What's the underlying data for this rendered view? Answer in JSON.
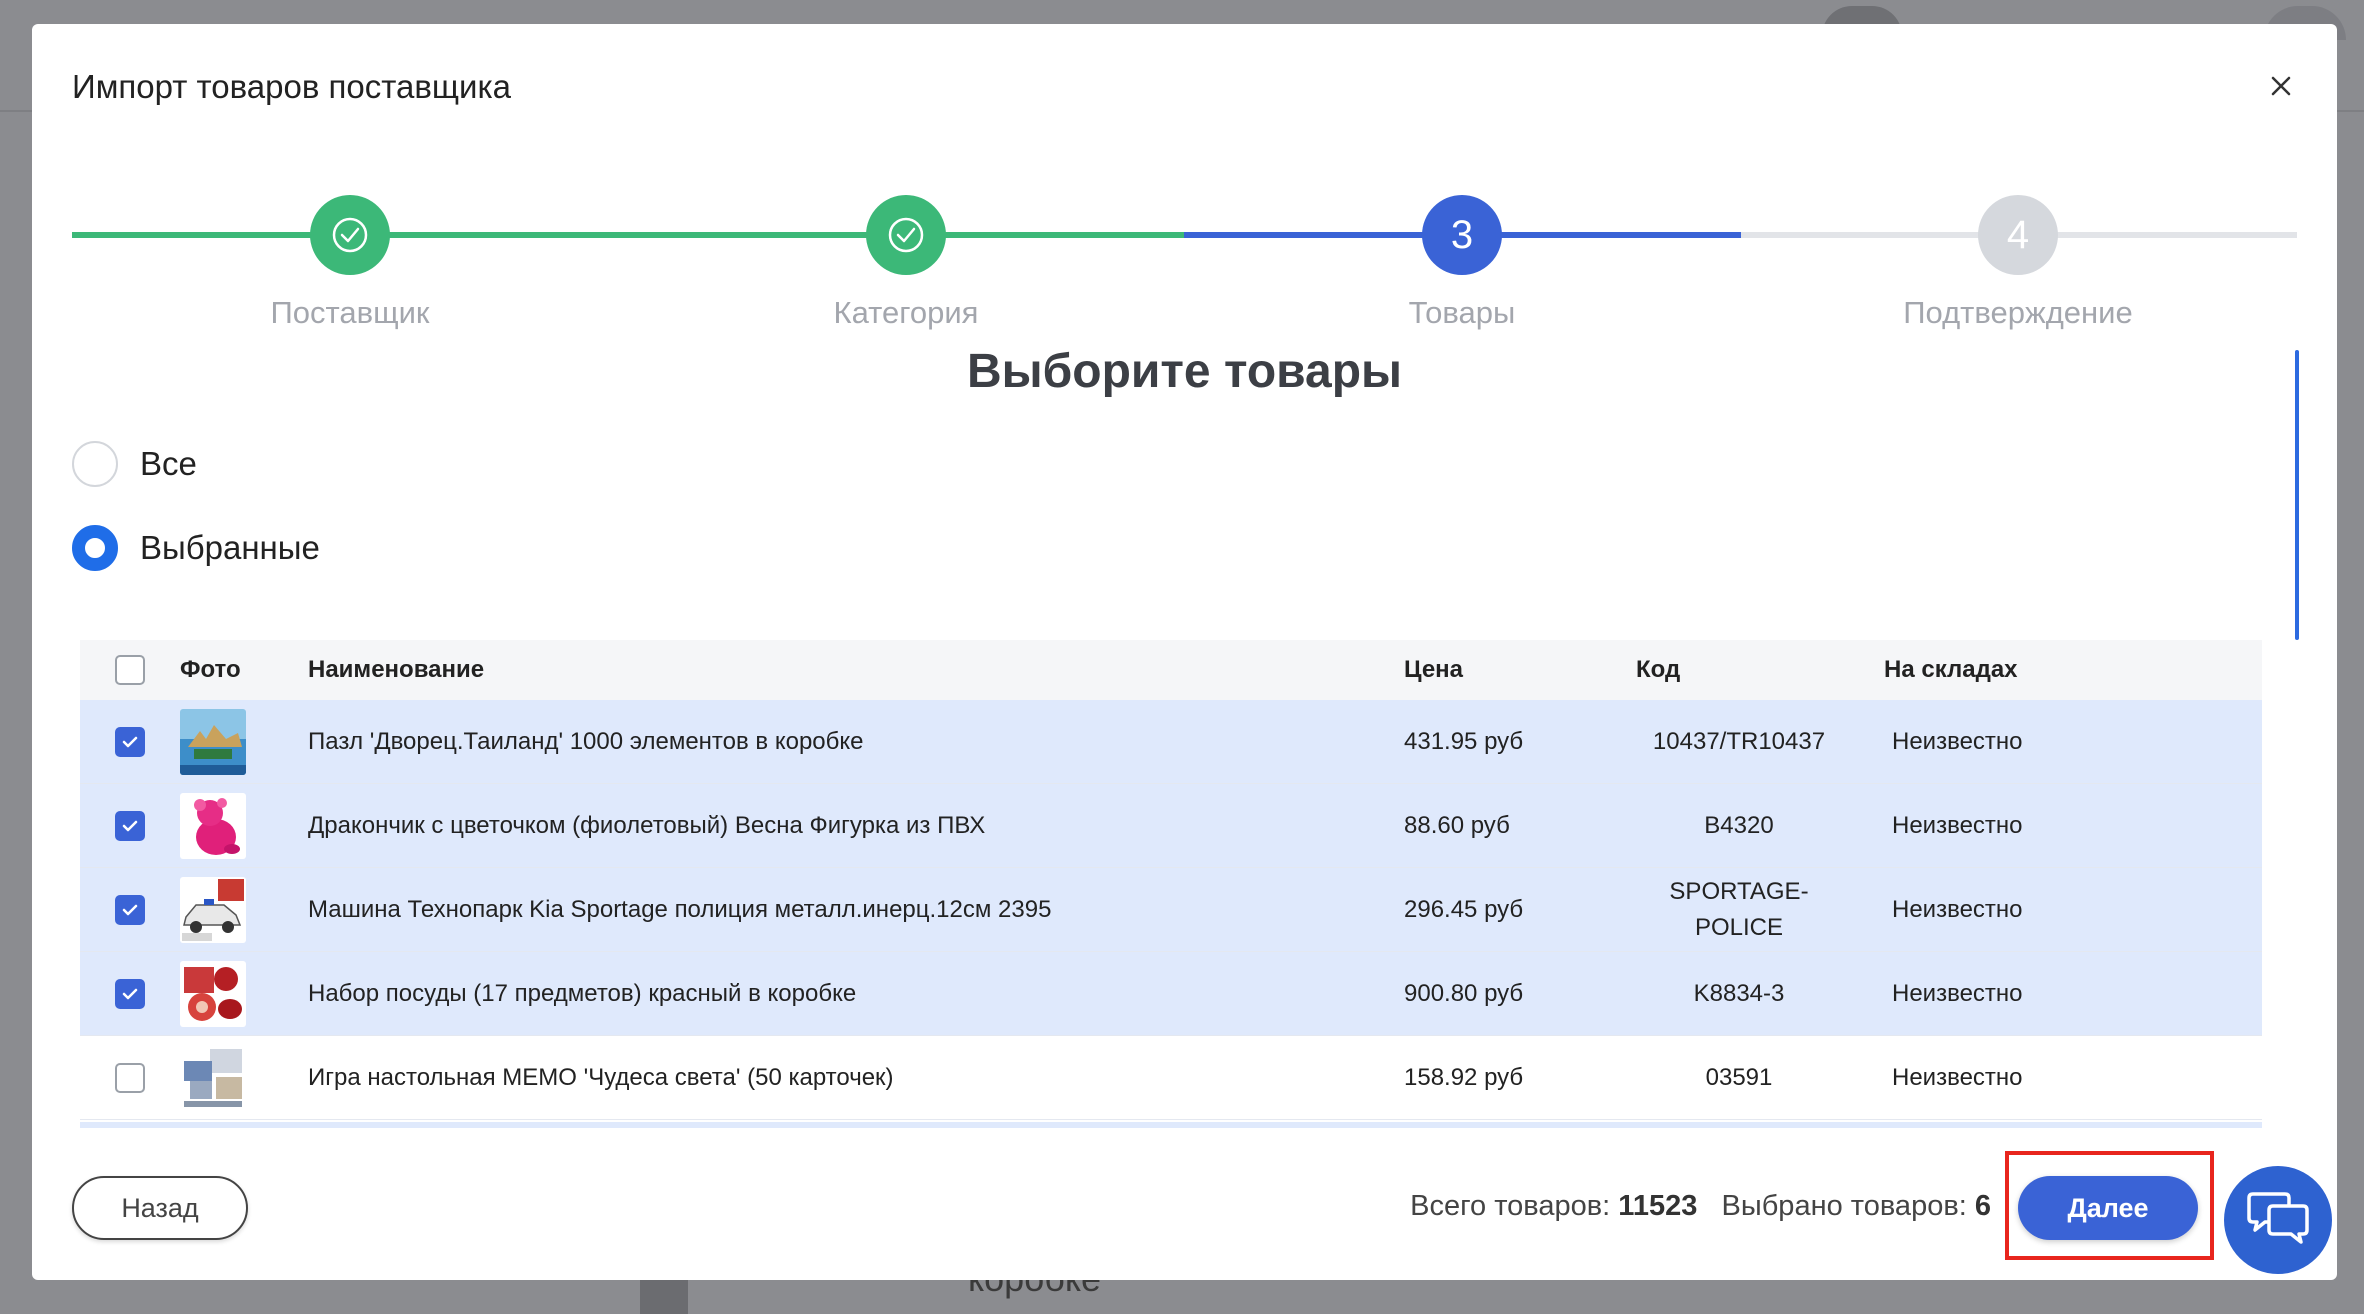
{
  "modal": {
    "title": "Импорт товаров поставщика",
    "heading": "Выборите товары"
  },
  "steps": [
    {
      "label": "Поставщик",
      "number": "1",
      "state": "done"
    },
    {
      "label": "Категория",
      "number": "2",
      "state": "done"
    },
    {
      "label": "Товары",
      "number": "3",
      "state": "active"
    },
    {
      "label": "Подтверждение",
      "number": "4",
      "state": "todo"
    }
  ],
  "filter": {
    "all_label": "Все",
    "selected_label": "Выбранные",
    "selected_value": "Выбранные"
  },
  "table": {
    "headers": {
      "photo": "Фото",
      "name": "Наименование",
      "price": "Цена",
      "code": "Код",
      "stock": "На складах"
    },
    "rows": [
      {
        "checked": true,
        "photo": "puzzle-palace-photo",
        "name": "Пазл 'Дворец.Таиланд' 1000 элементов в коробке",
        "price": "431.95 руб",
        "code": "10437/TR10437",
        "stock": "Неизвестно"
      },
      {
        "checked": true,
        "photo": "pink-dragon-figure-photo",
        "name": "Дракончик с цветочком (фиолетовый) Весна Фигурка из ПВХ",
        "price": "88.60 руб",
        "code": "B4320",
        "stock": "Неизвестно"
      },
      {
        "checked": true,
        "photo": "police-car-toy-photo",
        "name": "Машина Технопарк Kia Sportage полиция металл.инерц.12см 2395",
        "price": "296.45 руб",
        "code": "SPORTAGE-POLICE",
        "stock": "Неизвестно"
      },
      {
        "checked": true,
        "photo": "red-dish-set-photo",
        "name": "Набор посуды (17 предметов) красный в коробке",
        "price": "900.80 руб",
        "code": "K8834-3",
        "stock": "Неизвестно"
      },
      {
        "checked": false,
        "photo": "memo-cards-photo",
        "name": "Игра настольная МЕМО 'Чудеса света' (50 карточек)",
        "price": "158.92 руб",
        "code": "03591",
        "stock": "Неизвестно"
      }
    ]
  },
  "footer": {
    "back_label": "Назад",
    "next_label": "Далее",
    "total_label": "Всего товаров:",
    "total_value": "11523",
    "selected_label": "Выбрано товаров:",
    "selected_value": "6"
  },
  "background": {
    "peek_text": "коробке"
  },
  "colors": {
    "done": "#3cb878",
    "active": "#3a63d6",
    "todo": "#d5d8dd",
    "selected_row": "#dfe9fc",
    "highlight": "#e8251d"
  }
}
